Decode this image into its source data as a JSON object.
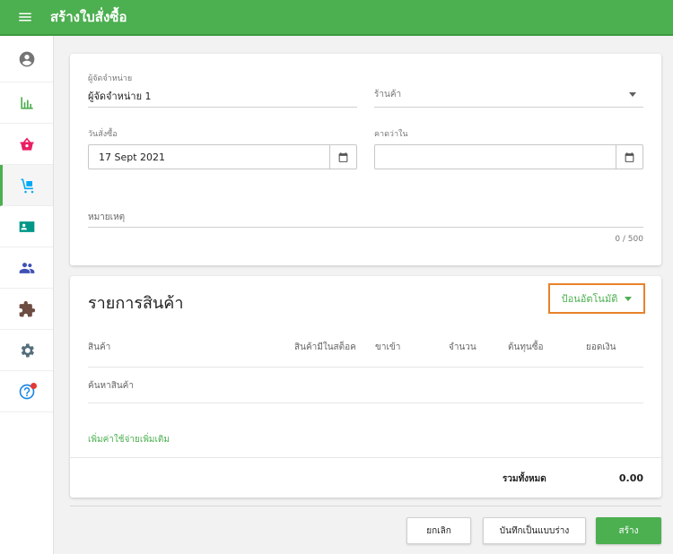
{
  "app": {
    "title": "สร้างใบสั่งซื้อ"
  },
  "sidebar": {
    "items": [
      {
        "icon": "account-circle-icon"
      },
      {
        "icon": "bar-chart-icon"
      },
      {
        "icon": "basket-icon"
      },
      {
        "icon": "cart-dolly-icon",
        "active": true
      },
      {
        "icon": "contact-card-icon"
      },
      {
        "icon": "people-icon"
      },
      {
        "icon": "puzzle-icon"
      },
      {
        "icon": "gear-icon"
      },
      {
        "icon": "help-icon",
        "notification": true
      }
    ]
  },
  "form": {
    "supplier_label": "ผู้จัดจำหน่าย",
    "supplier_value": "ผู้จัดจำหน่าย 1",
    "store_placeholder": "ร้านค้า",
    "order_date_label": "วันสั่งซื้อ",
    "order_date_value": "17 Sept 2021",
    "expected_label": "คาดว่าใน",
    "expected_value": "",
    "notes_label": "หมายเหตุ",
    "notes_counter": "0 / 500"
  },
  "items": {
    "title": "รายการสินค้า",
    "autofill_label": "ป้อนอัตโนมัติ",
    "columns": [
      "สินค้า",
      "สินค้ามีในสต็อค",
      "ขาเข้า",
      "จำนวน",
      "ต้นทุนซื้อ",
      "ยอดเงิน"
    ],
    "search_placeholder": "ค้นหาสินค้า",
    "add_cost_label": "เพิ่มค่าใช้จ่ายเพิ่มเติม",
    "total_label": "รวมทั้งหมด",
    "total_value": "0.00"
  },
  "actions": {
    "cancel_label": "ยกเลิก",
    "draft_label": "บันทึกเป็นแบบร่าง",
    "create_label": "สร้าง"
  },
  "colors": {
    "primary": "#4caf50",
    "highlight": "#e8822a",
    "notification": "#e53935"
  }
}
